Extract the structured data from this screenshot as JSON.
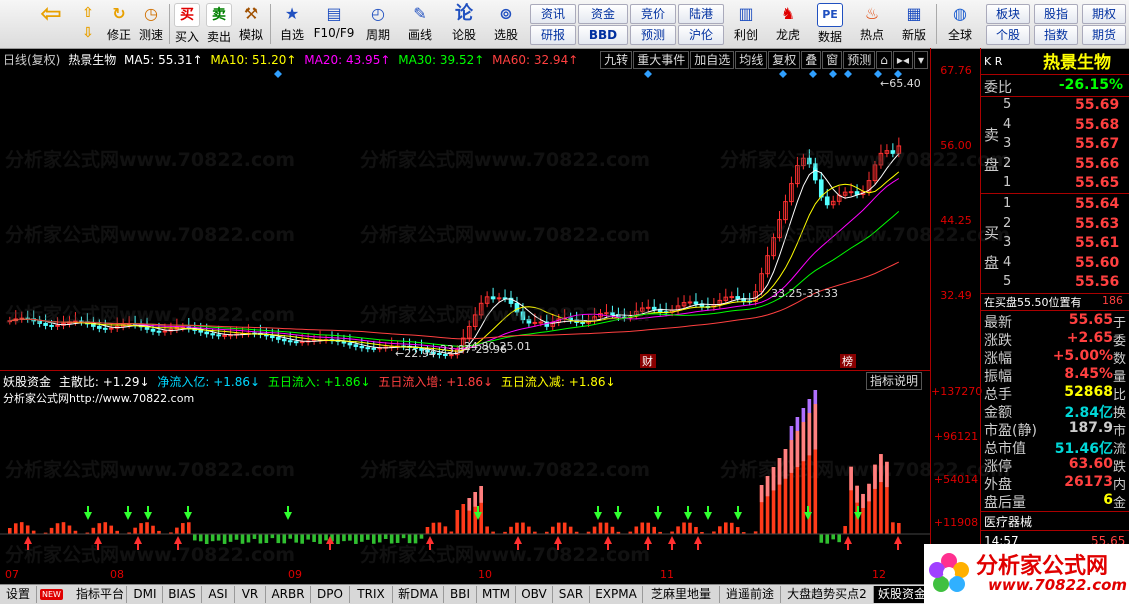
{
  "toolbar": {
    "buttons": [
      {
        "label": "",
        "icon": "back-arrow-icon"
      },
      {
        "label": "",
        "icon": "up-down-arrows-icon"
      },
      {
        "label": "修正",
        "icon": "undo-icon"
      },
      {
        "label": "测速",
        "icon": "clock-icon"
      },
      {
        "label": "买入",
        "icon": "buy-icon",
        "glyph": "买"
      },
      {
        "label": "卖出",
        "icon": "sell-icon",
        "glyph": "卖"
      },
      {
        "label": "模拟",
        "icon": "hammer-icon"
      },
      {
        "label": "自选",
        "icon": "star-folder-icon"
      },
      {
        "label": "F10/F9",
        "icon": "window-icon"
      },
      {
        "label": "周期",
        "icon": "period-icon"
      },
      {
        "label": "画线",
        "icon": "pencil-icon"
      },
      {
        "label": "论股",
        "icon": "discuss-icon",
        "glyph": "论"
      },
      {
        "label": "选股",
        "icon": "search-stock-icon"
      },
      {
        "label": "利创",
        "icon": "chart-window-icon"
      },
      {
        "label": "龙虎",
        "icon": "dragon-icon"
      },
      {
        "label": "数据",
        "icon": "pe-icon",
        "glyph": "PE"
      },
      {
        "label": "热点",
        "icon": "hot-icon"
      },
      {
        "label": "新版",
        "icon": "new-version-icon"
      },
      {
        "label": "全球",
        "icon": "globe-icon"
      }
    ],
    "small_buttons_row1": [
      "资讯",
      "资金",
      "竞价",
      "陆港"
    ],
    "small_buttons_row2": [
      "研报",
      "BBD",
      "预测",
      "沪伦"
    ],
    "right_buttons_row1": [
      "板块",
      "股指",
      "期权"
    ],
    "right_buttons_row2": [
      "个股",
      "指数",
      "期货"
    ]
  },
  "chart_header": {
    "period": "日线(复权)",
    "name": "热景生物",
    "ma5": "MA5: 55.31↑",
    "ma10": "MA10: 51.20↑",
    "ma20": "MA20: 43.95↑",
    "ma30": "MA30: 39.52↑",
    "ma60": "MA60: 32.94↑",
    "buttons": [
      "九转",
      "重大事件",
      "加自选",
      "均线",
      "复权",
      "叠",
      "窗",
      "预测"
    ]
  },
  "price_axis": {
    "labels": [
      "67.76",
      "56.00",
      "44.25",
      "32.49"
    ]
  },
  "volume_axis": {
    "labels": [
      "+137270",
      "+96121",
      "+54014",
      "+11908"
    ]
  },
  "annotations": {
    "high": "65.40",
    "low": "22.94",
    "range1": "23.87-23.96",
    "range2": "24.80-25.01",
    "range3": "33.25-33.33",
    "mark_cai": "财",
    "mark_bang": "榜"
  },
  "lower": {
    "title": "妖股资金",
    "main": "主散比: +1.29↓",
    "net": "净流入亿: +1.86↓",
    "five_in": "五日流入: +1.86↓",
    "five_inc": "五日流入增: +1.86↓",
    "five_dec": "五日流入减: +1.86↓",
    "url": "分析家公式网http://www.70822.com",
    "indicator_button": "指标说明"
  },
  "x_axis": {
    "labels": [
      "07",
      "08",
      "09",
      "10",
      "11",
      "12"
    ]
  },
  "bottom_tabs": [
    "设置",
    "指标平台",
    "DMI",
    "BIAS",
    "ASI",
    "VR",
    "ARBR",
    "DPO",
    "TRIX",
    "新DMA",
    "BBI",
    "MTM",
    "OBV",
    "SAR",
    "EXPMA",
    "芝麻里地量",
    "逍遥前途",
    "大盘趋势买点2",
    "妖股资金"
  ],
  "new_badge": "NEW",
  "right_panel": {
    "stock_name": "热景生物",
    "kr": "K R",
    "weibi_label": "委比",
    "weibi": "-26.15%",
    "sell_label": [
      "卖",
      "盘"
    ],
    "buy_label": [
      "买",
      "盘"
    ],
    "asks": [
      {
        "n": "5",
        "p": "55.69"
      },
      {
        "n": "4",
        "p": "55.68"
      },
      {
        "n": "3",
        "p": "55.67"
      },
      {
        "n": "2",
        "p": "55.66"
      },
      {
        "n": "1",
        "p": "55.65"
      }
    ],
    "bids": [
      {
        "n": "1",
        "p": "55.64"
      },
      {
        "n": "2",
        "p": "55.63"
      },
      {
        "n": "3",
        "p": "55.61"
      },
      {
        "n": "4",
        "p": "55.60"
      },
      {
        "n": "5",
        "p": "55.56"
      }
    ],
    "notice": "在买盘55.50位置有",
    "notice_num": "186",
    "stats": [
      {
        "k": "最新",
        "v": "55.65",
        "u": "于",
        "c": "#ff4040"
      },
      {
        "k": "涨跌",
        "v": "+2.65",
        "u": "委",
        "c": "#ff4040"
      },
      {
        "k": "涨幅",
        "v": "+5.00%",
        "u": "数",
        "c": "#ff4040"
      },
      {
        "k": "振幅",
        "v": "8.45%",
        "u": "量",
        "c": "#ff4040"
      },
      {
        "k": "总手",
        "v": "52868",
        "u": "比",
        "c": "#ffff00"
      },
      {
        "k": "金额",
        "v": "2.84亿",
        "u": "换",
        "c": "#00d8d8"
      },
      {
        "k": "市盈(静)",
        "v": "187.9",
        "u": "市",
        "c": "#ccc"
      },
      {
        "k": "总市值",
        "v": "51.46亿",
        "u": "流",
        "c": "#00d8d8"
      },
      {
        "k": "涨停",
        "v": "63.60",
        "u": "跌",
        "c": "#ff4040"
      },
      {
        "k": "外盘",
        "v": "26173",
        "u": "内",
        "c": "#ff4040"
      },
      {
        "k": "盘后量",
        "v": "6",
        "u": "金",
        "c": "#ffff00"
      }
    ],
    "sector": "医疗器械",
    "time": "14:57",
    "time_price": "55.65"
  },
  "watermark": "分析家公式网www.70822.com",
  "logo": {
    "text": "分析家公式网",
    "url": "www.70822.com"
  },
  "colors": {
    "up": "#ff3030",
    "down": "#54ffff",
    "ma5": "#ffffff",
    "ma10": "#ffff00",
    "ma20": "#ff00ff",
    "ma30": "#00ff00",
    "ma60": "#ff4040",
    "bar_red": "#ff3a1a",
    "bar_pink": "#ff8080",
    "bar_purple": "#b070ff",
    "bar_yellow": "#ffd000",
    "bar_green": "#30c030"
  }
}
